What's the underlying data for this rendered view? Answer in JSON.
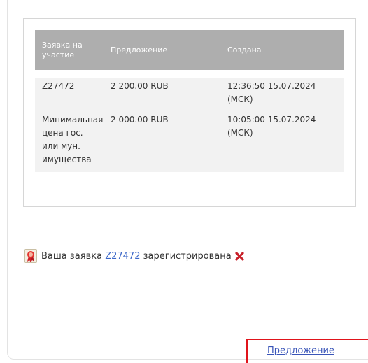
{
  "table": {
    "headers": [
      "Заявка на участие",
      "Предложение",
      "Создана"
    ],
    "rows": [
      [
        "Z27472",
        "2 200.00 RUB",
        "12:36:50 15.07.2024 (МСК)"
      ],
      [
        "Минимальная цена гос. или мун. имущества",
        "2 000.00 RUB",
        "10:05:00 15.07.2024 (МСК)"
      ]
    ]
  },
  "notice": {
    "prefix": "Ваша заявка",
    "bid_id": "Z27472",
    "suffix": "зарегистрирована"
  },
  "offer_link": "Предложение",
  "colors": {
    "header_bg": "#aeaeae",
    "row_bg": "#f2f2f2",
    "link": "#3a66c8",
    "highlight_border": "#e0141b",
    "close_icon": "#c8202a"
  },
  "icons": {
    "notice_icon": "ribbon-award-icon",
    "close_icon": "close-icon"
  }
}
